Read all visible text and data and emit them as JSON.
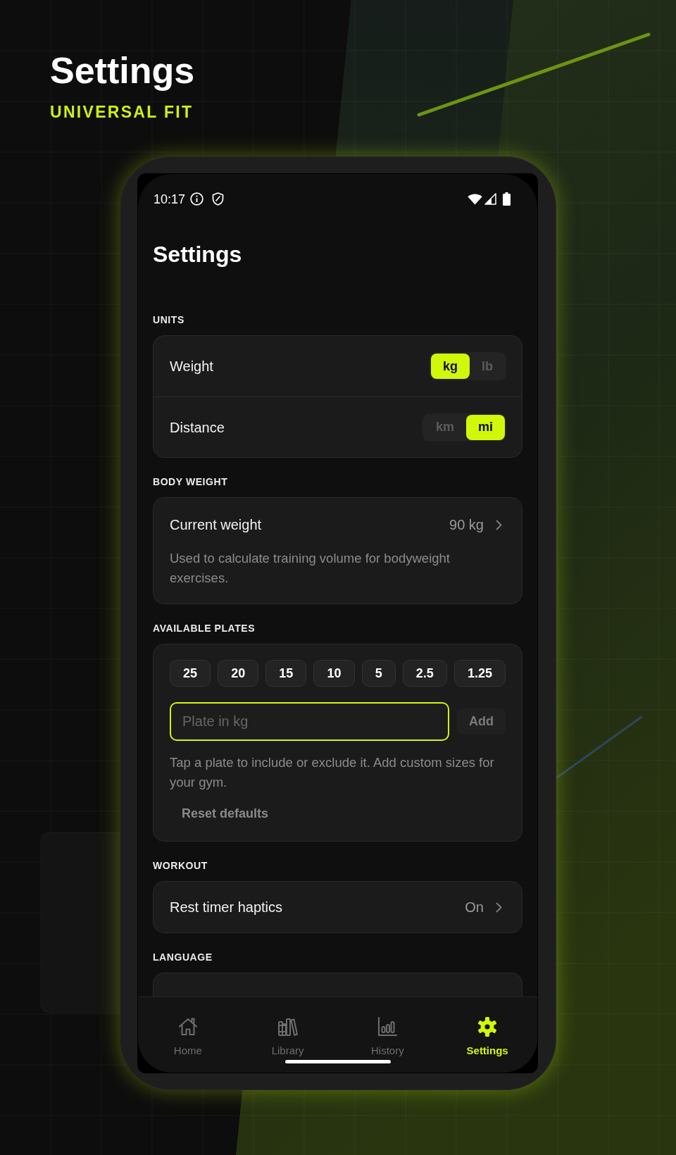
{
  "header": {
    "title": "Settings",
    "subtitle": "UNIVERSAL FIT"
  },
  "status_bar": {
    "time": "10:17"
  },
  "screen_title": "Settings",
  "sections": [
    {
      "kind": "units",
      "label": "UNITS",
      "rows": [
        {
          "label": "Weight",
          "options": [
            {
              "label": "kg",
              "selected": true
            },
            {
              "label": "lb",
              "selected": false
            }
          ]
        },
        {
          "label": "Distance",
          "options": [
            {
              "label": "km",
              "selected": false
            },
            {
              "label": "mi",
              "selected": true
            }
          ]
        }
      ]
    },
    {
      "kind": "value",
      "label": "BODY WEIGHT",
      "row": {
        "label": "Current weight",
        "value": "90 kg"
      },
      "description": "Used to calculate training volume for bodyweight exercises."
    },
    {
      "kind": "plates",
      "label": "AVAILABLE PLATES",
      "plates": [
        "25",
        "20",
        "15",
        "10",
        "5",
        "2.5",
        "1.25"
      ],
      "input": {
        "placeholder": "Plate in kg",
        "focused": true
      },
      "add_button": "Add",
      "help": "Tap a plate to include or exclude it. Add custom sizes for your gym.",
      "reset_button": "Reset defaults"
    },
    {
      "kind": "value",
      "label": "WORKOUT",
      "row": {
        "label": "Rest timer haptics",
        "value": "On"
      }
    },
    {
      "kind": "value",
      "label": "LANGUAGE"
    }
  ],
  "bottom_nav": [
    {
      "label": "Home",
      "selected": false
    },
    {
      "label": "Library",
      "selected": false
    },
    {
      "label": "History",
      "selected": false
    },
    {
      "label": "Settings",
      "selected": true
    }
  ]
}
